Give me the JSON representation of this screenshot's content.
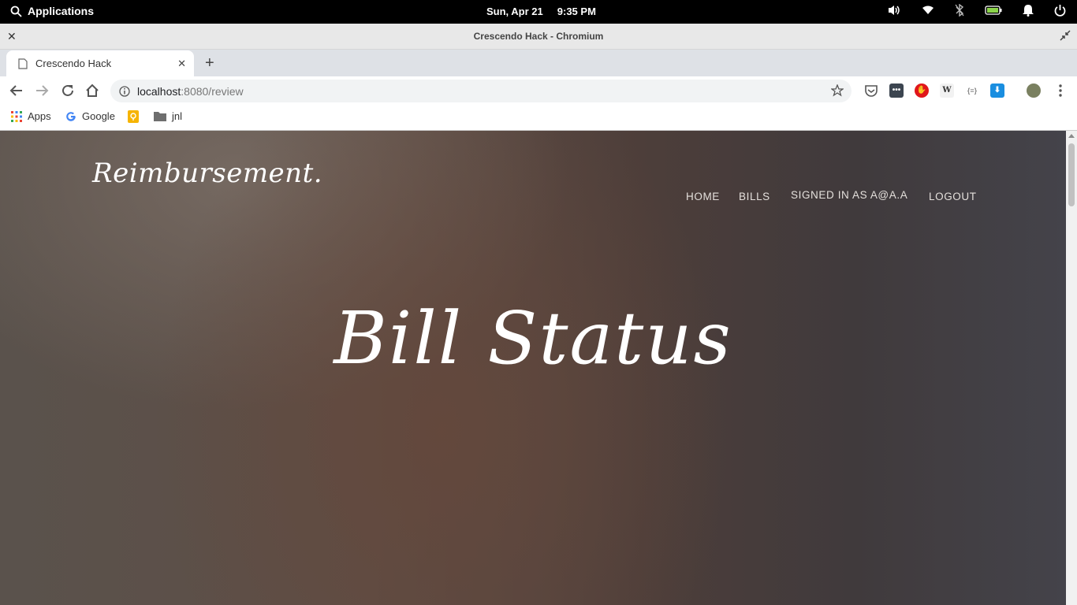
{
  "system_panel": {
    "apps_label": "Applications",
    "date": "Sun, Apr 21",
    "time": "9:35 PM",
    "tray_icons": [
      "volume-icon",
      "wifi-icon",
      "bluetooth-disabled-icon",
      "battery-icon",
      "notifications-icon",
      "power-icon"
    ]
  },
  "window": {
    "title": "Crescendo Hack - Chromium"
  },
  "tabs": [
    {
      "title": "Crescendo Hack"
    }
  ],
  "omnibox": {
    "host": "localhost",
    "path": ":8080/review"
  },
  "bookmarks": [
    {
      "label": "Apps",
      "icon": "apps-grid-icon"
    },
    {
      "label": "Google",
      "icon": "google-icon"
    },
    {
      "label": "",
      "icon": "keep-icon"
    },
    {
      "label": "jnl",
      "icon": "folder-icon"
    }
  ],
  "extensions": [
    "pocket-icon",
    "lastpass-icon",
    "adblock-icon",
    "wikipedia-icon",
    "json-icon",
    "download-icon",
    "avatar"
  ],
  "page": {
    "brand": "Reimbursement.",
    "nav": {
      "home": "HOME",
      "bills": "BILLS",
      "signed_in": "SIGNED IN AS A@A.A",
      "logout": "LOGOUT"
    },
    "hero_title": "Bill Status"
  },
  "colors": {
    "page_background": "#5a4a44",
    "hero_text": "#ffffff",
    "nav_text": "#e4e0dc"
  }
}
